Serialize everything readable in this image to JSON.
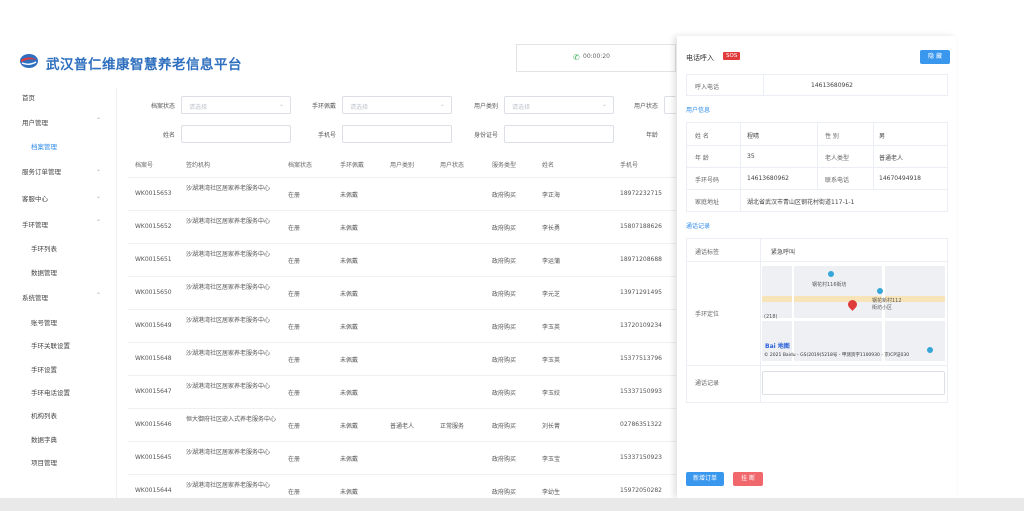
{
  "header": {
    "title": "武汉普仁维康智慧养老信息平台",
    "call_timer": "00:00:20"
  },
  "sidebar": {
    "items": [
      {
        "label": "首页"
      },
      {
        "label": "用户管理"
      },
      {
        "label": "档案管理"
      },
      {
        "label": "服务订单管理"
      },
      {
        "label": "客服中心"
      },
      {
        "label": "手环管理"
      },
      {
        "label": "手环列表"
      },
      {
        "label": "数据管理"
      },
      {
        "label": "系统管理"
      },
      {
        "label": "账号管理"
      },
      {
        "label": "手环关联设置"
      },
      {
        "label": "手环设置"
      },
      {
        "label": "手环电话设置"
      },
      {
        "label": "机构列表"
      },
      {
        "label": "数据字典"
      },
      {
        "label": "项目管理"
      }
    ]
  },
  "filters": {
    "archive_status_label": "档案状态",
    "bracelet_label": "手环佩戴",
    "user_type_label": "用户类别",
    "user_status_label": "用户状态",
    "name_label": "姓名",
    "phone_label": "手机号",
    "id_label": "身份证号",
    "age_label": "年龄",
    "select_placeholder": "请选择"
  },
  "table": {
    "headers": [
      "档案号",
      "签约机构",
      "档案状态",
      "手环佩戴",
      "用户类别",
      "用户状态",
      "服务类型",
      "姓名",
      "手机号"
    ],
    "rows": [
      {
        "id": "WK0015653",
        "org": "沙湖港湾社区居家养老服务中心",
        "status": "在册",
        "bracelet": "未佩戴",
        "type": "",
        "ustatus": "",
        "service": "政府购买",
        "name": "李正海",
        "phone": "18972232715"
      },
      {
        "id": "WK0015652",
        "org": "沙湖港湾社区居家养老服务中心",
        "status": "在册",
        "bracelet": "未佩戴",
        "type": "",
        "ustatus": "",
        "service": "政府购买",
        "name": "李长勇",
        "phone": "15807188626"
      },
      {
        "id": "WK0015651",
        "org": "沙湖港湾社区居家养老服务中心",
        "status": "在册",
        "bracelet": "未佩戴",
        "type": "",
        "ustatus": "",
        "service": "政府购买",
        "name": "李运蒲",
        "phone": "18971208688"
      },
      {
        "id": "WK0015650",
        "org": "沙湖港湾社区居家养老服务中心",
        "status": "在册",
        "bracelet": "未佩戴",
        "type": "",
        "ustatus": "",
        "service": "政府购买",
        "name": "李元芝",
        "phone": "13971291495"
      },
      {
        "id": "WK0015649",
        "org": "沙湖港湾社区居家养老服务中心",
        "status": "在册",
        "bracelet": "未佩戴",
        "type": "",
        "ustatus": "",
        "service": "政府购买",
        "name": "李玉英",
        "phone": "13720109234"
      },
      {
        "id": "WK0015648",
        "org": "沙湖港湾社区居家养老服务中心",
        "status": "在册",
        "bracelet": "未佩戴",
        "type": "",
        "ustatus": "",
        "service": "政府购买",
        "name": "李玉英",
        "phone": "15377513796"
      },
      {
        "id": "WK0015647",
        "org": "沙湖港湾社区居家养老服务中心",
        "status": "在册",
        "bracelet": "未佩戴",
        "type": "",
        "ustatus": "",
        "service": "政府购买",
        "name": "李玉姣",
        "phone": "15337150993"
      },
      {
        "id": "WK0015646",
        "org": "恒大御府社区嵌入式养老服务中心",
        "status": "在册",
        "bracelet": "未佩戴",
        "type": "普通老人",
        "ustatus": "正常服务",
        "service": "政府购买",
        "name": "刘长菁",
        "phone": "02786351322"
      },
      {
        "id": "WK0015645",
        "org": "沙湖港湾社区居家养老服务中心",
        "status": "在册",
        "bracelet": "未佩戴",
        "type": "",
        "ustatus": "",
        "service": "政府购买",
        "name": "李玉宝",
        "phone": "15337150923"
      },
      {
        "id": "WK0015644",
        "org": "沙湖港湾社区居家养老服务中心",
        "status": "在册",
        "bracelet": "未佩戴",
        "type": "",
        "ustatus": "",
        "service": "政府购买",
        "name": "李幼生",
        "phone": "15972050282"
      }
    ]
  },
  "panel": {
    "title": "电话呼入",
    "sos": "SOS",
    "hide_button": "隐 藏",
    "caller_label": "呼入电话",
    "caller_value": "14613680962",
    "user_info_title": "用户信息",
    "name_label": "姓 名",
    "name_value": "程晴",
    "gender_label": "性 别",
    "gender_value": "男",
    "age_label": "年 龄",
    "age_value": "35",
    "elder_type_label": "老人类型",
    "elder_type_value": "普通老人",
    "bracelet_no_label": "手环号码",
    "bracelet_no_value": "14613680962",
    "contact_label": "联系电话",
    "contact_value": "14670494918",
    "address_label": "家庭地址",
    "address_value": "湖北省武汉市青山区钢花村街道117-1-1",
    "call_record_title": "通话记录",
    "call_tag_label": "通话标签",
    "call_tag_value": "紧急呼叫",
    "location_label": "手环定位",
    "record_label": "通话记录",
    "new_order_button": "新增订单",
    "hangup_button": "挂 断",
    "map": {
      "label1": "钢花村116街坊",
      "label2": "钢花新村112",
      "label3": "街坊小区",
      "label4": "(218)",
      "baidu": "Bai 地图",
      "copyright": "© 2021 Baidu - GS(2019)5218号 - 甲测资字1100930 - 京ICP证030"
    }
  }
}
